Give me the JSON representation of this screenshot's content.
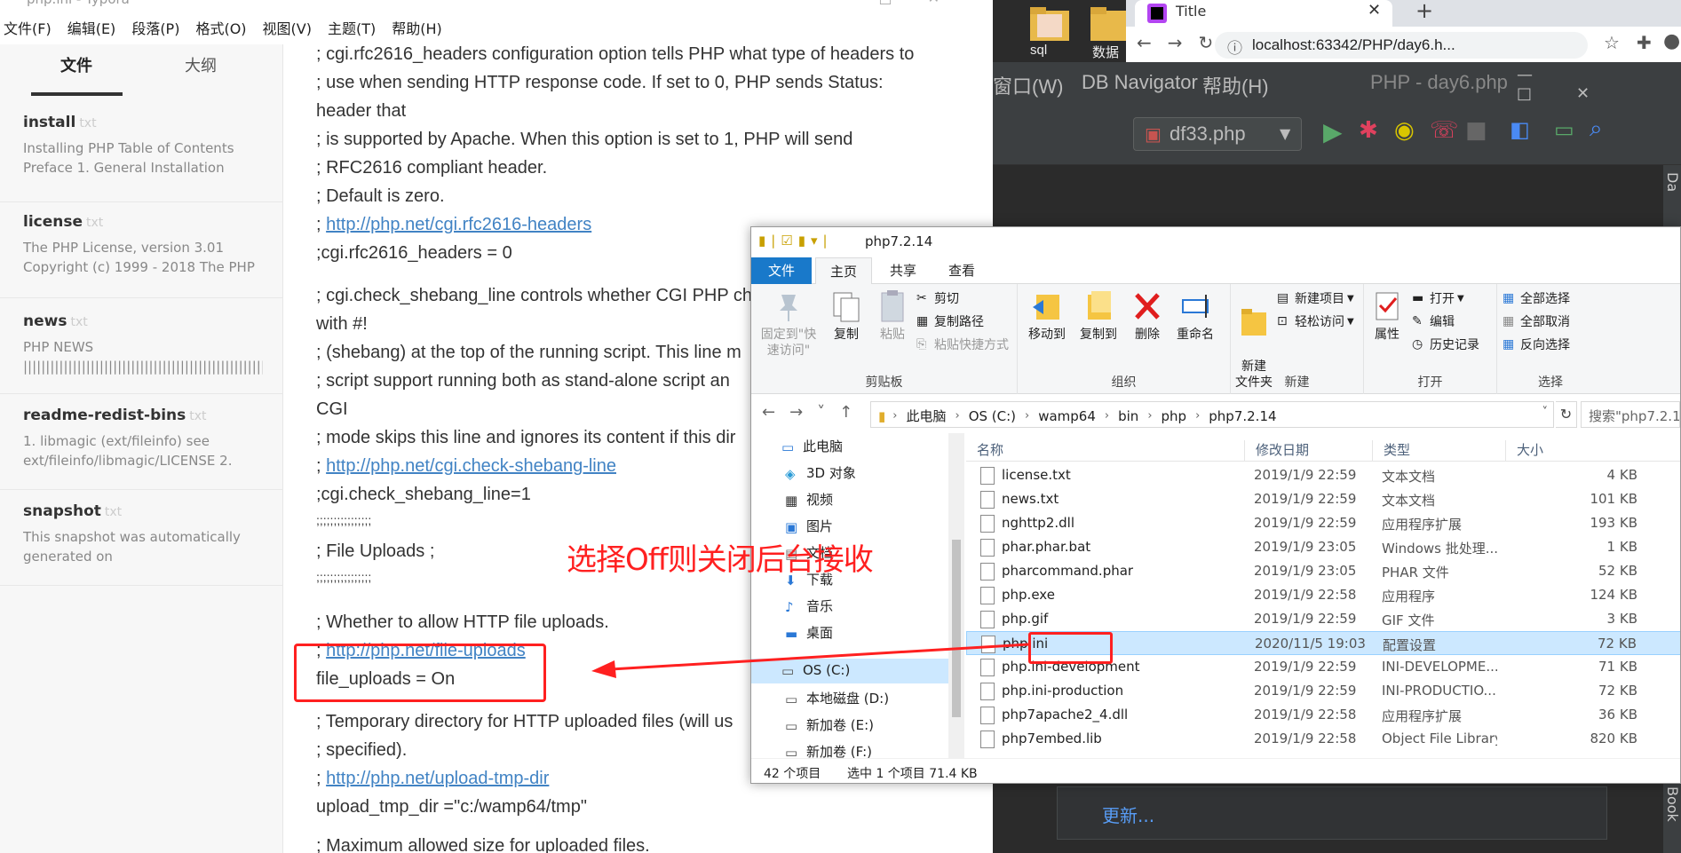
{
  "typora": {
    "title": "php.ini - Typora",
    "menus": [
      "文件(F)",
      "编辑(E)",
      "段落(P)",
      "格式(O)",
      "视图(V)",
      "主题(T)",
      "帮助(H)"
    ],
    "sidebar_tabs": {
      "files": "文件",
      "outline": "大纲"
    },
    "files": [
      {
        "name": "install",
        "ext": "txt",
        "desc": "Installing PHP Table of Contents\nPreface 1. General Installation"
      },
      {
        "name": "license",
        "ext": "txt",
        "desc": "The PHP License, version 3.01\nCopyright (c) 1999 - 2018 The PHP"
      },
      {
        "name": "news",
        "ext": "txt",
        "desc": "PHP NEWS\n||||||||||||||||||||||||||||||||||||||||||||||||||||||||||||||..."
      },
      {
        "name": "readme-redist-bins",
        "ext": "txt",
        "desc": "1. libmagic (ext/fileinfo) see\next/fileinfo/libmagic/LICENSE 2."
      },
      {
        "name": "snapshot",
        "ext": "txt",
        "desc": "This snapshot was automatically\ngenerated on"
      }
    ],
    "lines": [
      {
        "text": "; cgi.rfc2616_headers configuration option tells PHP what type of headers to",
        "link": false
      },
      {
        "text": "; use when sending HTTP response code. If set to 0, PHP sends Status:",
        "link": false
      },
      {
        "text": "header that",
        "link": false
      },
      {
        "text": "; is supported by Apache. When this option is set to 1, PHP will send",
        "link": false
      },
      {
        "text": "; RFC2616 compliant header.",
        "link": false
      },
      {
        "text": "; Default is zero.",
        "link": false
      },
      {
        "prefix": "; ",
        "text": "http://php.net/cgi.rfc2616-headers",
        "link": true
      },
      {
        "text": ";cgi.rfc2616_headers = 0",
        "link": false
      },
      {
        "text": "; cgi.check_shebang_line controls whether CGI PHP ch",
        "link": false
      },
      {
        "text": "with #!",
        "link": false
      },
      {
        "text": "; (shebang) at the top of the running script. This line m",
        "link": false
      },
      {
        "text": "; script support running both as stand-alone script an",
        "link": false
      },
      {
        "text": "CGI",
        "link": false
      },
      {
        "text": "; mode skips this line and ignores its content if this dir",
        "link": false
      },
      {
        "prefix": "; ",
        "text": "http://php.net/cgi.check-shebang-line",
        "link": true
      },
      {
        "text": ";cgi.check_shebang_line=1",
        "link": false
      },
      {
        "text": ";;;;;;;;;;;;;;;;",
        "link": false
      },
      {
        "text": "; File Uploads ;",
        "link": false
      },
      {
        "text": ";;;;;;;;;;;;;;;;",
        "link": false
      },
      {
        "text": "; Whether to allow HTTP file uploads.",
        "link": false
      },
      {
        "prefix": "; ",
        "text": "http://php.net/file-uploads",
        "link": true
      },
      {
        "text": "file_uploads = On",
        "link": false
      },
      {
        "text": "; Temporary directory for HTTP uploaded files (will us",
        "link": false
      },
      {
        "text": "; specified).",
        "link": false
      },
      {
        "prefix": "; ",
        "text": "http://php.net/upload-tmp-dir",
        "link": true
      },
      {
        "text": "upload_tmp_dir =\"c:/wamp64/tmp\"",
        "link": false
      },
      {
        "text": "; Maximum allowed size for uploaded files.",
        "link": false
      }
    ]
  },
  "annotation": {
    "text": "选择Off则关闭后台接收",
    "color": "#ff2020"
  },
  "desktop": {
    "folder_labels": [
      "sql",
      "数据"
    ]
  },
  "chrome": {
    "tab_title": "Title",
    "url": "localhost:63342/PHP/day6.h..."
  },
  "ide": {
    "menus": [
      "窗口(W)",
      "DB Navigator",
      "帮助(H)"
    ],
    "title": "PHP - day6.php",
    "run_config": "df33.php",
    "update_label": "更新...",
    "right_tool_top": "Da",
    "right_tool_bottom": "Book"
  },
  "explorer": {
    "title": "php7.2.14",
    "tabs": [
      "文件",
      "主页",
      "共享",
      "查看"
    ],
    "ribbon": {
      "clipboard": {
        "label": "剪贴板",
        "pin": "固定到\"快速访问\"",
        "copy": "复制",
        "paste": "粘贴",
        "cut": "剪切",
        "copy_path": "复制路径",
        "paste_shortcut": "粘贴快捷方式"
      },
      "organize": {
        "label": "组织",
        "move_to": "移动到",
        "copy_to": "复制到",
        "delete": "删除",
        "rename": "重命名"
      },
      "new": {
        "label": "新建",
        "new_folder": "新建\n文件夹",
        "new_item": "新建项目",
        "easy_access": "轻松访问"
      },
      "open": {
        "label": "打开",
        "properties": "属性",
        "open": "打开",
        "edit": "编辑",
        "history": "历史记录"
      },
      "select": {
        "label": "选择",
        "select_all": "全部选择",
        "select_none": "全部取消",
        "invert": "反向选择"
      }
    },
    "breadcrumb": [
      "此电脑",
      "OS (C:)",
      "wamp64",
      "bin",
      "php",
      "php7.2.14"
    ],
    "search_placeholder": "搜索\"php7.2.14\"",
    "nav": [
      {
        "label": "此电脑",
        "icon": "pc-icon"
      },
      {
        "label": "3D 对象",
        "icon": "3d-objects-icon"
      },
      {
        "label": "视频",
        "icon": "video-icon"
      },
      {
        "label": "图片",
        "icon": "pictures-icon"
      },
      {
        "label": "文档",
        "icon": "documents-icon"
      },
      {
        "label": "下载",
        "icon": "download-icon"
      },
      {
        "label": "音乐",
        "icon": "music-icon"
      },
      {
        "label": "桌面",
        "icon": "desktop-icon"
      },
      {
        "label": "OS (C:)",
        "icon": "drive-c-icon"
      },
      {
        "label": "本地磁盘 (D:)",
        "icon": "drive-icon"
      },
      {
        "label": "新加卷 (E:)",
        "icon": "drive-icon"
      },
      {
        "label": "新加卷 (F:)",
        "icon": "drive-icon"
      }
    ],
    "columns": {
      "name": "名称",
      "date": "修改日期",
      "type": "类型",
      "size": "大小"
    },
    "files": [
      {
        "name": "license.txt",
        "date": "2019/1/9 22:59",
        "type": "文本文档",
        "size": "4 KB"
      },
      {
        "name": "news.txt",
        "date": "2019/1/9 22:59",
        "type": "文本文档",
        "size": "101 KB"
      },
      {
        "name": "nghttp2.dll",
        "date": "2019/1/9 22:59",
        "type": "应用程序扩展",
        "size": "193 KB"
      },
      {
        "name": "phar.phar.bat",
        "date": "2019/1/9 23:05",
        "type": "Windows 批处理...",
        "size": "1 KB"
      },
      {
        "name": "pharcommand.phar",
        "date": "2019/1/9 23:05",
        "type": "PHAR 文件",
        "size": "52 KB"
      },
      {
        "name": "php.exe",
        "date": "2019/1/9 22:58",
        "type": "应用程序",
        "size": "124 KB"
      },
      {
        "name": "php.gif",
        "date": "2019/1/9 22:59",
        "type": "GIF 文件",
        "size": "3 KB"
      },
      {
        "name": "php.ini",
        "date": "2020/11/5 19:03",
        "type": "配置设置",
        "size": "72 KB",
        "selected": true
      },
      {
        "name": "php.ini-development",
        "date": "2019/1/9 22:59",
        "type": "INI-DEVELOPME...",
        "size": "71 KB"
      },
      {
        "name": "php.ini-production",
        "date": "2019/1/9 22:59",
        "type": "INI-PRODUCTIO...",
        "size": "72 KB"
      },
      {
        "name": "php7apache2_4.dll",
        "date": "2019/1/9 22:58",
        "type": "应用程序扩展",
        "size": "36 KB"
      },
      {
        "name": "php7embed.lib",
        "date": "2019/1/9 22:58",
        "type": "Object File Library",
        "size": "820 KB"
      }
    ],
    "status": {
      "count": "42 个项目",
      "selection": "选中 1 个项目  71.4 KB"
    }
  }
}
